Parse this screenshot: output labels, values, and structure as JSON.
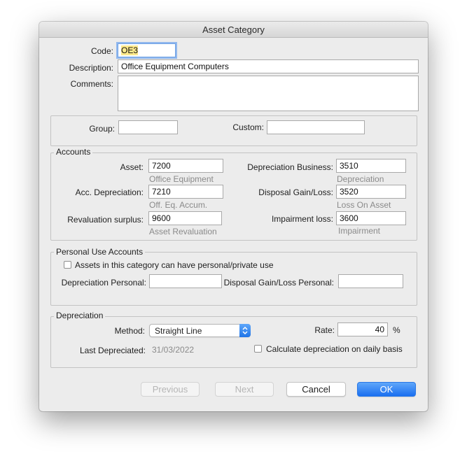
{
  "window": {
    "title": "Asset Category"
  },
  "top": {
    "code_label": "Code:",
    "code_value": "OE3",
    "description_label": "Description:",
    "description_value": "Office Equipment Computers",
    "comments_label": "Comments:",
    "comments_value": ""
  },
  "group_box": {
    "group_label": "Group:",
    "group_value": "",
    "custom_label": "Custom:",
    "custom_value": ""
  },
  "accounts": {
    "title": "Accounts",
    "asset_label": "Asset:",
    "asset_value": "7200",
    "asset_desc": "Office Equipment",
    "acc_dep_label": "Acc. Depreciation:",
    "acc_dep_value": "7210",
    "acc_dep_desc": "Off. Eq. Accum.",
    "reval_label": "Revaluation surplus:",
    "reval_value": "9600",
    "reval_desc": "Asset Revaluation",
    "dep_business_label": "Depreciation Business:",
    "dep_business_value": "3510",
    "dep_business_desc": "Depreciation",
    "disposal_label": "Disposal Gain/Loss:",
    "disposal_value": "3520",
    "disposal_desc": "Loss On Asset",
    "impairment_label": "Impairment loss:",
    "impairment_value": "3600",
    "impairment_desc": "Impairment"
  },
  "personal": {
    "title": "Personal Use Accounts",
    "checkbox_label": "Assets in this category can have personal/private use",
    "checked": false,
    "dep_personal_label": "Depreciation Personal:",
    "dep_personal_value": "",
    "disposal_personal_label": "Disposal Gain/Loss Personal:",
    "disposal_personal_value": ""
  },
  "depreciation": {
    "title": "Depreciation",
    "method_label": "Method:",
    "method_value": "Straight Line",
    "rate_label": "Rate:",
    "rate_value": "40",
    "rate_unit": "%",
    "last_label": "Last Depreciated:",
    "last_value": "31/03/2022",
    "daily_label": "Calculate depreciation on daily basis",
    "daily_checked": false
  },
  "buttons": {
    "previous": "Previous",
    "next": "Next",
    "cancel": "Cancel",
    "ok": "OK"
  },
  "colors": {
    "accent": "#1a6ff0",
    "code_highlight": "#fde98b",
    "window_bg": "#ececec"
  }
}
